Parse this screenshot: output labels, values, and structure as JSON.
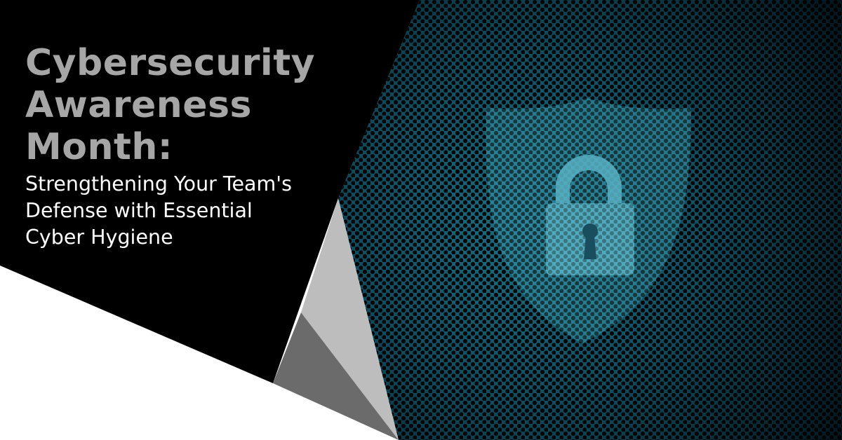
{
  "headline": {
    "title_lines": [
      "Cybersecurity",
      "Awareness",
      "Month:"
    ],
    "subtitle_lines": [
      "Strengthening Your Team's",
      "Defense with Essential",
      "Cyber Hygiene"
    ]
  },
  "illustration": {
    "shield_icon": "shield-icon",
    "lock_icon": "padlock-icon",
    "background_pattern": "perforated-metal-mesh"
  },
  "colors": {
    "dark_panel": "#000000",
    "title": "#a6a6a6",
    "subtitle": "#ffffff",
    "mesh_glow": "#1a6e82",
    "shield_fill": "#3fa3b8",
    "lock_fill": "#5fc0d4",
    "light_gray_triangle": "#bdbdbd",
    "mid_gray_triangle": "#6b6b6b",
    "background": "#ffffff"
  }
}
